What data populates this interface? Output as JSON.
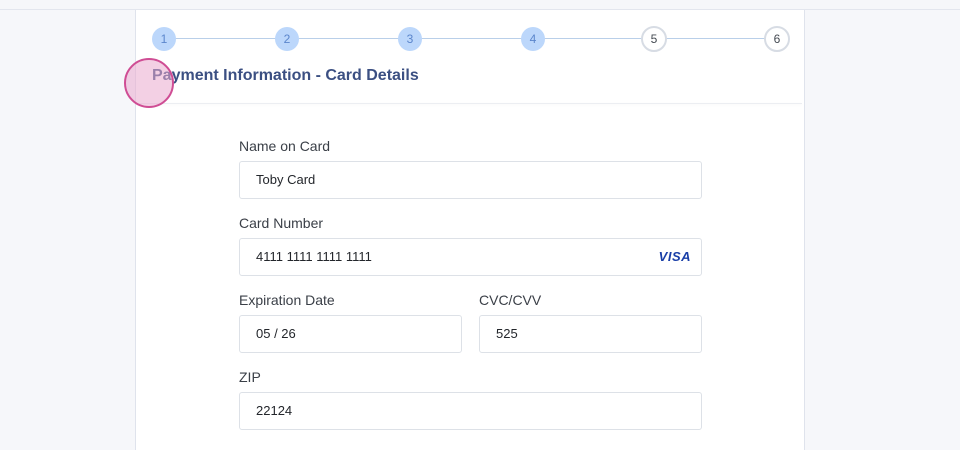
{
  "stepper": {
    "steps": [
      {
        "label": "1",
        "state": "done"
      },
      {
        "label": "2",
        "state": "done"
      },
      {
        "label": "3",
        "state": "done"
      },
      {
        "label": "4",
        "state": "done"
      },
      {
        "label": "5",
        "state": "todo"
      },
      {
        "label": "6",
        "state": "todo"
      }
    ]
  },
  "section": {
    "title": "Payment Information - Card Details"
  },
  "form": {
    "name_on_card": {
      "label": "Name on Card",
      "value": "Toby Card"
    },
    "card_number": {
      "label": "Card Number",
      "value": "4111 1111 1111 1111",
      "brand": "VISA"
    },
    "expiration": {
      "label": "Expiration Date",
      "value": "05 / 26"
    },
    "cvc": {
      "label": "CVC/CVV",
      "value": "525"
    },
    "zip": {
      "label": "ZIP",
      "value": "22124"
    }
  },
  "colors": {
    "accent": "#3b4f82",
    "step_done_bg": "#bcd7fb",
    "brand_visa": "#1a3fa8",
    "cursor_highlight": "#cf4d94"
  }
}
